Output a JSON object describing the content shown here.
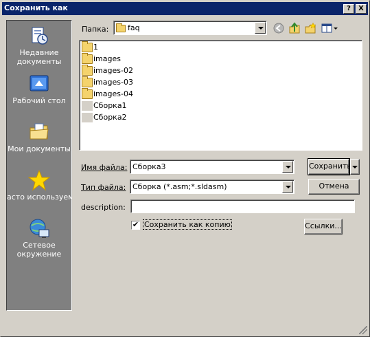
{
  "window": {
    "title": "Сохранить как",
    "help_glyph": "?",
    "close_glyph": "X"
  },
  "places": [
    {
      "label_line1": "Недавние",
      "label_line2": "документы",
      "icon": "recent-documents-icon"
    },
    {
      "label_line1": "Рабочий стол",
      "label_line2": "",
      "icon": "desktop-icon"
    },
    {
      "label_line1": "Мои документы",
      "label_line2": "",
      "icon": "my-documents-icon"
    },
    {
      "label_line1": "асто используем",
      "label_line2": "",
      "icon": "star-icon"
    },
    {
      "label_line1": "Сетевое",
      "label_line2": "окружение",
      "icon": "network-icon"
    }
  ],
  "folder_bar": {
    "label": "Папка:",
    "value": "faq"
  },
  "files": [
    {
      "name": "1",
      "type": "folder"
    },
    {
      "name": "images",
      "type": "folder"
    },
    {
      "name": "images-02",
      "type": "folder"
    },
    {
      "name": "images-03",
      "type": "folder"
    },
    {
      "name": "images-04",
      "type": "folder"
    },
    {
      "name": "Сборка1",
      "type": "assembly"
    },
    {
      "name": "Сборка2",
      "type": "assembly"
    }
  ],
  "form": {
    "filename_label": "Имя файла:",
    "filename_value": "Сборка3",
    "filetype_label": "Тип файла:",
    "filetype_value": "Сборка (*.asm;*.sldasm)",
    "description_label": "description:",
    "description_value": "",
    "save_copy_label": "Сохранить как копию",
    "save_copy_checked": "✔"
  },
  "buttons": {
    "save": "Сохранить",
    "cancel": "Отмена",
    "links": "Ссылки..."
  }
}
